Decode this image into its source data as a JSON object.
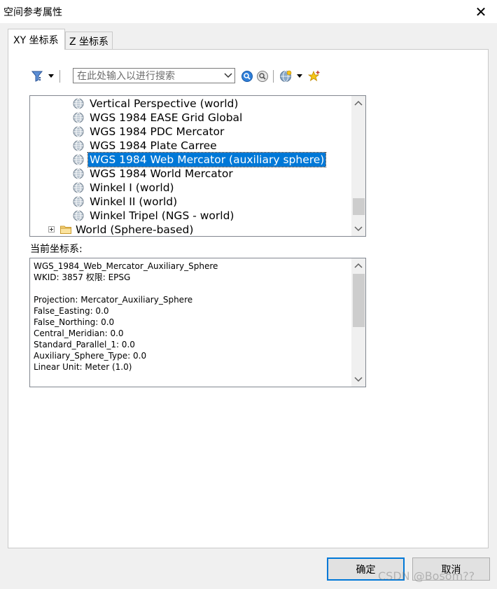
{
  "window": {
    "title": "空间参考属性",
    "close_glyph": "✕"
  },
  "tabs": [
    {
      "label": "XY 坐标系",
      "active": true
    },
    {
      "label": "Z 坐标系",
      "active": false
    }
  ],
  "toolbar": {
    "search_placeholder": "在此处输入以进行搜索"
  },
  "tree": {
    "items": [
      {
        "label": "Vertical Perspective (world)",
        "icon": "globe-icon",
        "selected": false
      },
      {
        "label": "WGS 1984 EASE Grid Global",
        "icon": "globe-icon",
        "selected": false
      },
      {
        "label": "WGS 1984 PDC Mercator",
        "icon": "globe-icon",
        "selected": false
      },
      {
        "label": "WGS 1984 Plate Carree",
        "icon": "globe-icon",
        "selected": false
      },
      {
        "label": "WGS 1984 Web Mercator (auxiliary sphere)",
        "icon": "globe-icon",
        "selected": true
      },
      {
        "label": "WGS 1984 World Mercator",
        "icon": "globe-icon",
        "selected": false
      },
      {
        "label": "Winkel I (world)",
        "icon": "globe-icon",
        "selected": false
      },
      {
        "label": "Winkel II (world)",
        "icon": "globe-icon",
        "selected": false
      },
      {
        "label": "Winkel Tripel (NGS - world)",
        "icon": "globe-icon",
        "selected": false
      }
    ],
    "folder": {
      "label": "World (Sphere-based)",
      "icon": "folder-icon",
      "expander": "plus-icon"
    }
  },
  "current": {
    "label": "当前坐标系:",
    "lines": [
      "WGS_1984_Web_Mercator_Auxiliary_Sphere",
      "WKID: 3857 权限: EPSG",
      "",
      "Projection: Mercator_Auxiliary_Sphere",
      "False_Easting: 0.0",
      "False_Northing: 0.0",
      "Central_Meridian: 0.0",
      "Standard_Parallel_1: 0.0",
      "Auxiliary_Sphere_Type: 0.0",
      "Linear Unit: Meter (1.0)"
    ]
  },
  "buttons": {
    "ok": "确定",
    "cancel": "取消"
  },
  "watermark": "CSDN @Bosom??",
  "colors": {
    "selection": "#0078d7",
    "dialog_bg": "#f0f0f0"
  }
}
